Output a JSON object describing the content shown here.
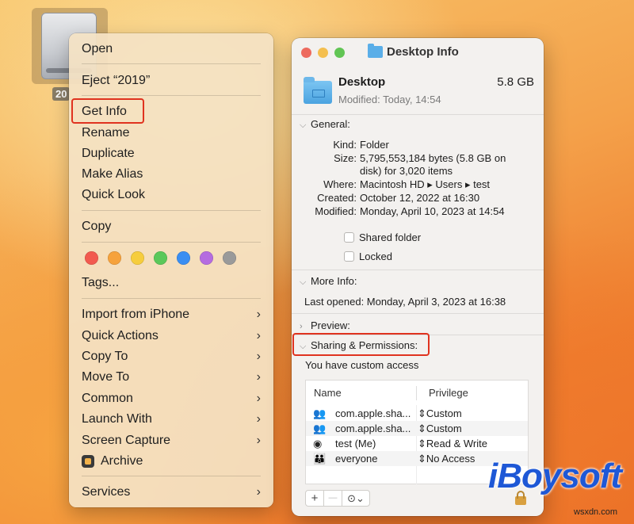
{
  "desktop": {
    "drive_label": "20"
  },
  "context_menu": {
    "open": "Open",
    "eject": "Eject “2019”",
    "get_info": "Get Info",
    "rename": "Rename",
    "duplicate": "Duplicate",
    "make_alias": "Make Alias",
    "quick_look": "Quick Look",
    "copy": "Copy",
    "tag_colors": [
      "#f25a4f",
      "#f6a23c",
      "#f6cd3d",
      "#5bc85a",
      "#3a8ef2",
      "#b56ce0",
      "#9a9a9a"
    ],
    "tags": "Tags...",
    "import_from_iphone": "Import from iPhone",
    "quick_actions": "Quick Actions",
    "copy_to": "Copy To",
    "move_to": "Move To",
    "common": "Common",
    "launch_with": "Launch With",
    "screen_capture": "Screen Capture",
    "archive": "Archive",
    "services": "Services",
    "submenu_chevron": "›"
  },
  "info_window": {
    "title": "Desktop Info",
    "name": "Desktop",
    "size": "5.8 GB",
    "modified_header": "Modified: Today, 14:54",
    "general": {
      "heading": "General:",
      "kind_label": "Kind:",
      "kind": "Folder",
      "size_label": "Size:",
      "size_line1": "5,795,553,184 bytes (5.8 GB on",
      "size_line2": "disk) for 3,020 items",
      "where_label": "Where:",
      "where": "Macintosh HD ▸ Users ▸ test",
      "created_label": "Created:",
      "created": "October 12, 2022 at 16:30",
      "modified_label": "Modified:",
      "modified": "Monday, April 10, 2023 at 14:54",
      "shared_folder": "Shared folder",
      "locked": "Locked"
    },
    "more_info": {
      "heading": "More Info:",
      "last_opened": "Last opened: Monday, April 3, 2023 at 16:38"
    },
    "preview": {
      "heading": "Preview:"
    },
    "sharing": {
      "heading": "Sharing & Permissions:",
      "access_note": "You have custom access",
      "col_name": "Name",
      "col_privilege": "Privilege",
      "rows": [
        {
          "icon": "group-icon",
          "name": "com.apple.sha...",
          "privilege": "Custom"
        },
        {
          "icon": "group-icon",
          "name": "com.apple.sha...",
          "privilege": "Custom"
        },
        {
          "icon": "user-icon",
          "name": "test (Me)",
          "privilege": "Read & Write"
        },
        {
          "icon": "everyone-icon",
          "name": "everyone",
          "privilege": "No Access"
        }
      ],
      "add": "+",
      "remove": "—",
      "action": "⊙⌄"
    }
  },
  "watermark": {
    "brand": "iBoysoft",
    "site": "wsxdn.com",
    "brand_color": "#1e58d6"
  }
}
